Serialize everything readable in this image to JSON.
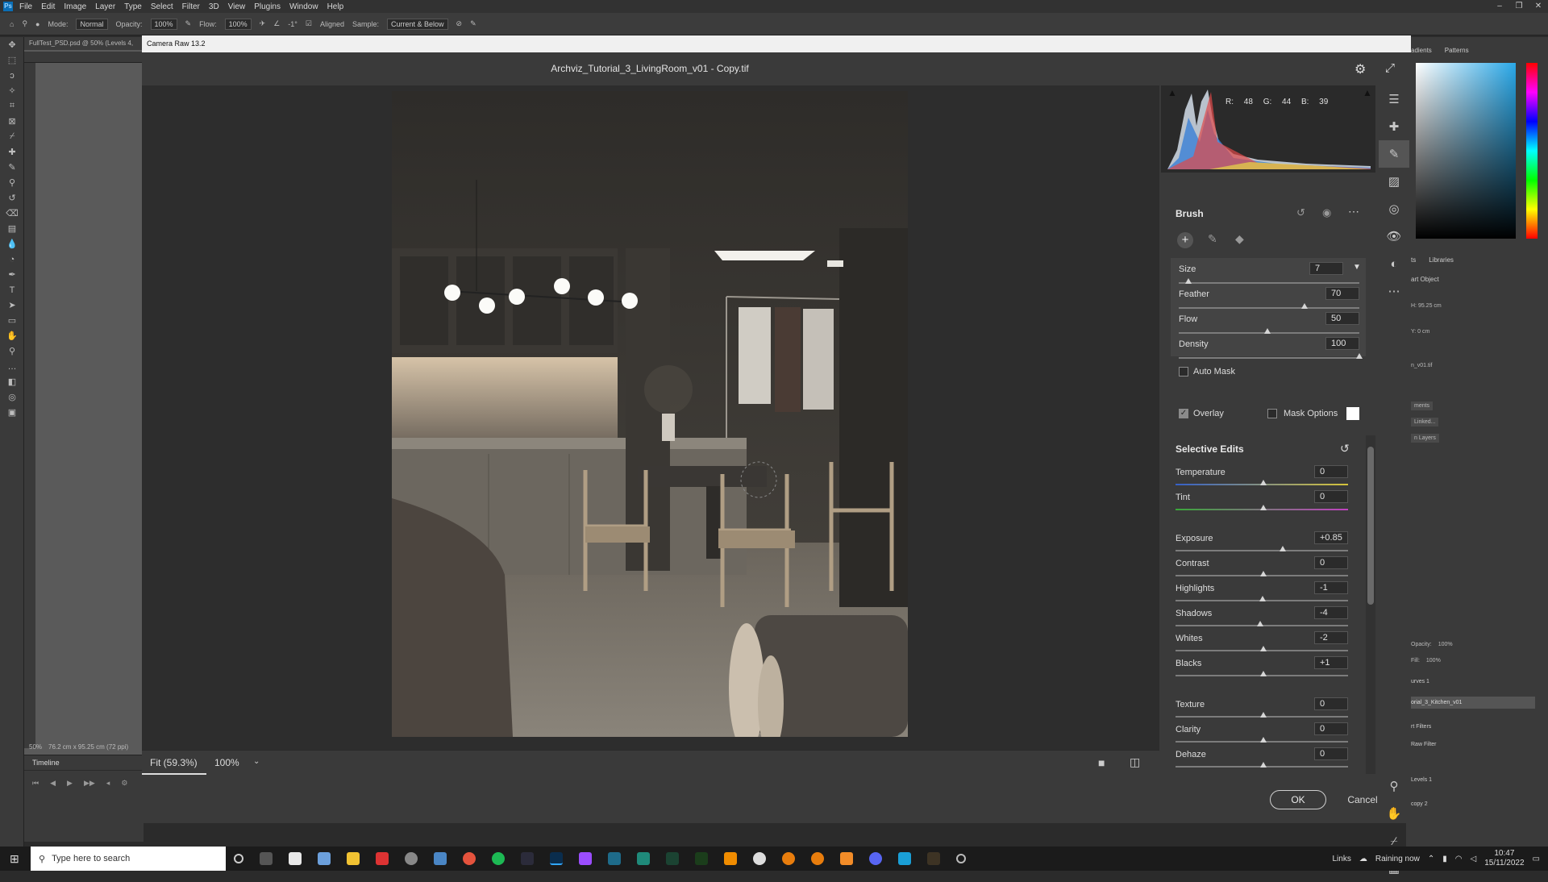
{
  "menu": [
    "File",
    "Edit",
    "Image",
    "Layer",
    "Type",
    "Select",
    "Filter",
    "3D",
    "View",
    "Plugins",
    "Window",
    "Help"
  ],
  "options": {
    "mode_label": "Mode:",
    "mode": "Normal",
    "opacity_label": "Opacity:",
    "opacity": "100%",
    "flow_label": "Flow:",
    "flow": "100%",
    "angle": "-1°",
    "aligned": "Aligned",
    "sample_label": "Sample:",
    "sample": "Current & Below"
  },
  "doc_tab": "FullTest_PSD.psd @ 50% (Levels 4,",
  "ps_status": {
    "zoom": "50%",
    "size": "76.2 cm x 95.25 cm (72 ppi)"
  },
  "timeline_label": "Timeline",
  "dialog": {
    "app_title": "Camera Raw 13.2",
    "file_title": "Archviz_Tutorial_3_LivingRoom_v01 - Copy.tif",
    "zoom_fit": "Fit (59.3%)",
    "zoom_pct": "100%",
    "ok": "OK",
    "cancel": "Cancel"
  },
  "histogram": {
    "r": "R: 48",
    "g": "G: 44",
    "b": "B: 39"
  },
  "brush": {
    "title": "Brush",
    "size_label": "Size",
    "size": "7",
    "feather_label": "Feather",
    "feather": "70",
    "flow_label": "Flow",
    "flow": "50",
    "density_label": "Density",
    "density": "100",
    "automask": "Auto Mask",
    "overlay": "Overlay",
    "mask_options": "Mask Options"
  },
  "selective": {
    "title": "Selective Edits",
    "rows": [
      {
        "label": "Temperature",
        "value": "0"
      },
      {
        "label": "Tint",
        "value": "0"
      },
      {
        "label": "Exposure",
        "value": "+0.85"
      },
      {
        "label": "Contrast",
        "value": "0"
      },
      {
        "label": "Highlights",
        "value": "-1"
      },
      {
        "label": "Shadows",
        "value": "-4"
      },
      {
        "label": "Whites",
        "value": "-2"
      },
      {
        "label": "Blacks",
        "value": "+1"
      },
      {
        "label": "Texture",
        "value": "0"
      },
      {
        "label": "Clarity",
        "value": "0"
      },
      {
        "label": "Dehaze",
        "value": "0"
      }
    ]
  },
  "right_panels": {
    "tab_gradients": "adients",
    "tab_patterns": "Patterns",
    "tab_libraries": "Libraries",
    "smart": "art Object",
    "h": "H: 95.25 cm",
    "y": "Y: 0 cm",
    "file": "n_v01.tif",
    "b1": "ments",
    "b2": "Linked...",
    "b3": "n Layers",
    "opacity_label": "Opacity:",
    "opacity": "100%",
    "fill_label": "Fill:",
    "fill": "100%",
    "l1": "urves 1",
    "l2": "orial_3_Kitchen_v01",
    "l3": "rt Filters",
    "l4": "Raw Filter",
    "l5": "Levels 1",
    "l6": "copy 2"
  },
  "taskbar": {
    "search": "Type here to search",
    "links": "Links",
    "weather": "Raining now",
    "time": "10:47",
    "date": "15/11/2022"
  }
}
